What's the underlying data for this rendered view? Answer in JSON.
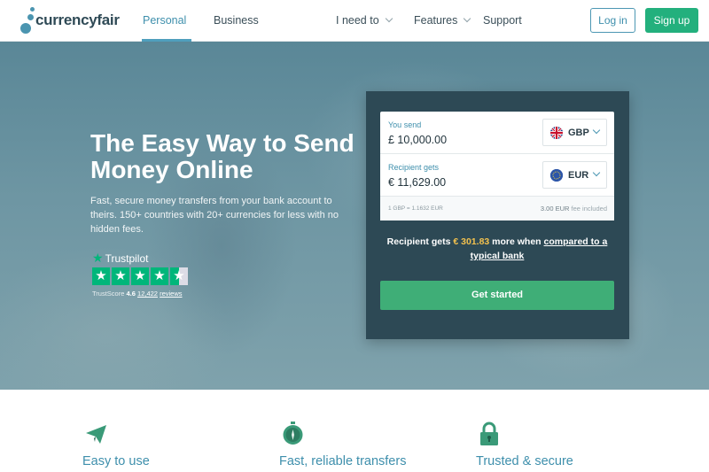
{
  "nav": {
    "logo_text": "currencyfair",
    "tabs": [
      {
        "label": "Personal",
        "active": true
      },
      {
        "label": "Business",
        "active": false
      }
    ],
    "menu": [
      {
        "label": "I need to",
        "has_dropdown": true
      },
      {
        "label": "Features",
        "has_dropdown": true
      },
      {
        "label": "Support",
        "has_dropdown": false
      }
    ],
    "login_label": "Log in",
    "signup_label": "Sign up"
  },
  "hero": {
    "title": "The Easy Way to Send Money Online",
    "subtitle": "Fast, secure money transfers from your bank account to theirs. 150+ countries with 20+ currencies for less with no hidden fees.",
    "trustpilot": {
      "brand": "Trustpilot",
      "rating_stars": 4.5,
      "score_label": "TrustScore",
      "score": "4.6",
      "reviews_count": "12,422",
      "reviews_label": "reviews"
    }
  },
  "converter": {
    "send_label": "You send",
    "send_amount": "£ 10,000.00",
    "send_currency": "GBP",
    "receive_label": "Recipient gets",
    "receive_amount": "€ 11,629.00",
    "receive_currency": "EUR",
    "rate_text": "1 GBP = 1.1632 EUR",
    "fee_amount": "3.00 EUR",
    "fee_label": "fee included",
    "savings_prefix": "Recipient gets",
    "savings_amount": "€ 301.83",
    "savings_middle": "more when",
    "savings_link": "compared to a typical bank",
    "cta_label": "Get started"
  },
  "features": [
    {
      "icon": "paper-plane-icon",
      "title": "Easy to use"
    },
    {
      "icon": "stopwatch-icon",
      "title": "Fast, reliable transfers"
    },
    {
      "icon": "padlock-icon",
      "title": "Trusted & secure"
    }
  ],
  "colors": {
    "brand_blue": "#3e8fac",
    "signup_green": "#23b07d",
    "cta_green": "#3fae77",
    "card_bg": "#2d4955",
    "savings_amount": "#f2c14e",
    "trustpilot_green": "#00b67a"
  }
}
